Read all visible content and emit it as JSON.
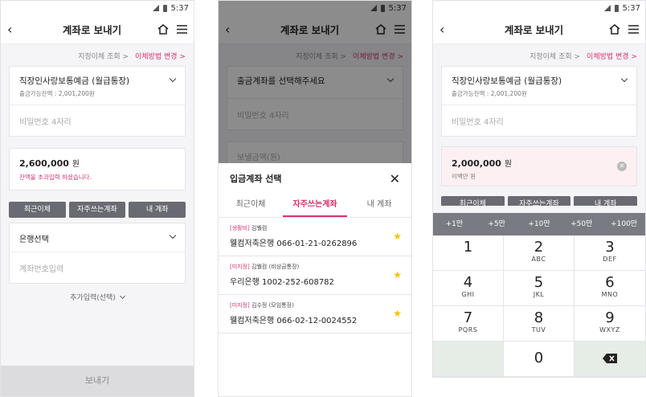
{
  "status": {
    "time": "5:37"
  },
  "screen1": {
    "title": "계좌로 보내기",
    "link_history": "지정이체 조회 >",
    "link_change": "이체방법 변경 >",
    "account_name": "직장인사랑보통예금 (월급통장)",
    "account_balance": "출금가능잔액 : 2,001,200원",
    "password_placeholder": "비밀번호 4자리",
    "amount_value": "2,600,000",
    "amount_unit": "원",
    "amount_error": "잔액을 초과입력 하셨습니다.",
    "pills": [
      "최근이체",
      "자주쓰는계좌",
      "내 계좌"
    ],
    "bank_select": "은행선택",
    "account_number_placeholder": "계좌번호입력",
    "more_input": "추가입력(선택)",
    "send_button": "보내기"
  },
  "screen2": {
    "title": "계좌로 보내기",
    "link_history": "지정이체 조회 >",
    "link_change": "이체방법 변경 >",
    "withdraw_select": "출금계좌를 선택해주세요",
    "password_placeholder": "비밀번호 4자리",
    "amount_placeholder": "보낼금액(원)",
    "sheet_title": "입금계좌 선택",
    "tabs": [
      "최근이체",
      "자주쓰는계좌",
      "내 계좌"
    ],
    "favorites": [
      {
        "tag": "[생활비]",
        "owner": "김웰컴",
        "account": "웰컴저축은행 066-01-21-0262896"
      },
      {
        "tag": "[미지정]",
        "owner": "김웰컴 (비상금통장)",
        "account": "우리은행 1002-252-608782"
      },
      {
        "tag": "[미지정]",
        "owner": "김수정 (모임통장)",
        "account": "웰컴저축은행 066-02-12-0024552"
      }
    ]
  },
  "screen3": {
    "title": "계좌로 보내기",
    "link_history": "지정이체 조회 >",
    "link_change": "이체방법 변경 >",
    "account_name": "직장인사랑보통예금 (월급통장)",
    "account_balance": "출금가능잔액 : 2,001,200원",
    "password_placeholder": "비밀번호 4자리",
    "amount_value": "2,000,000",
    "amount_unit": "원",
    "amount_korean": "이백만 원",
    "pills": [
      "최근이체",
      "자주쓰는계좌",
      "내 계좌"
    ],
    "quick_amounts": [
      "+1만",
      "+5만",
      "+10만",
      "+50만",
      "+100만"
    ],
    "keys": [
      {
        "num": "1",
        "letters": ""
      },
      {
        "num": "2",
        "letters": "ABC"
      },
      {
        "num": "3",
        "letters": "DEF"
      },
      {
        "num": "4",
        "letters": "GHI"
      },
      {
        "num": "5",
        "letters": "JKL"
      },
      {
        "num": "6",
        "letters": "MNO"
      },
      {
        "num": "7",
        "letters": "PQRS"
      },
      {
        "num": "8",
        "letters": "TUV"
      },
      {
        "num": "9",
        "letters": "WXYZ"
      },
      {
        "num": "0",
        "letters": ""
      }
    ]
  },
  "colors": {
    "accent": "#d6336c",
    "pill": "#6a6a72",
    "star": "#f4c20d"
  }
}
